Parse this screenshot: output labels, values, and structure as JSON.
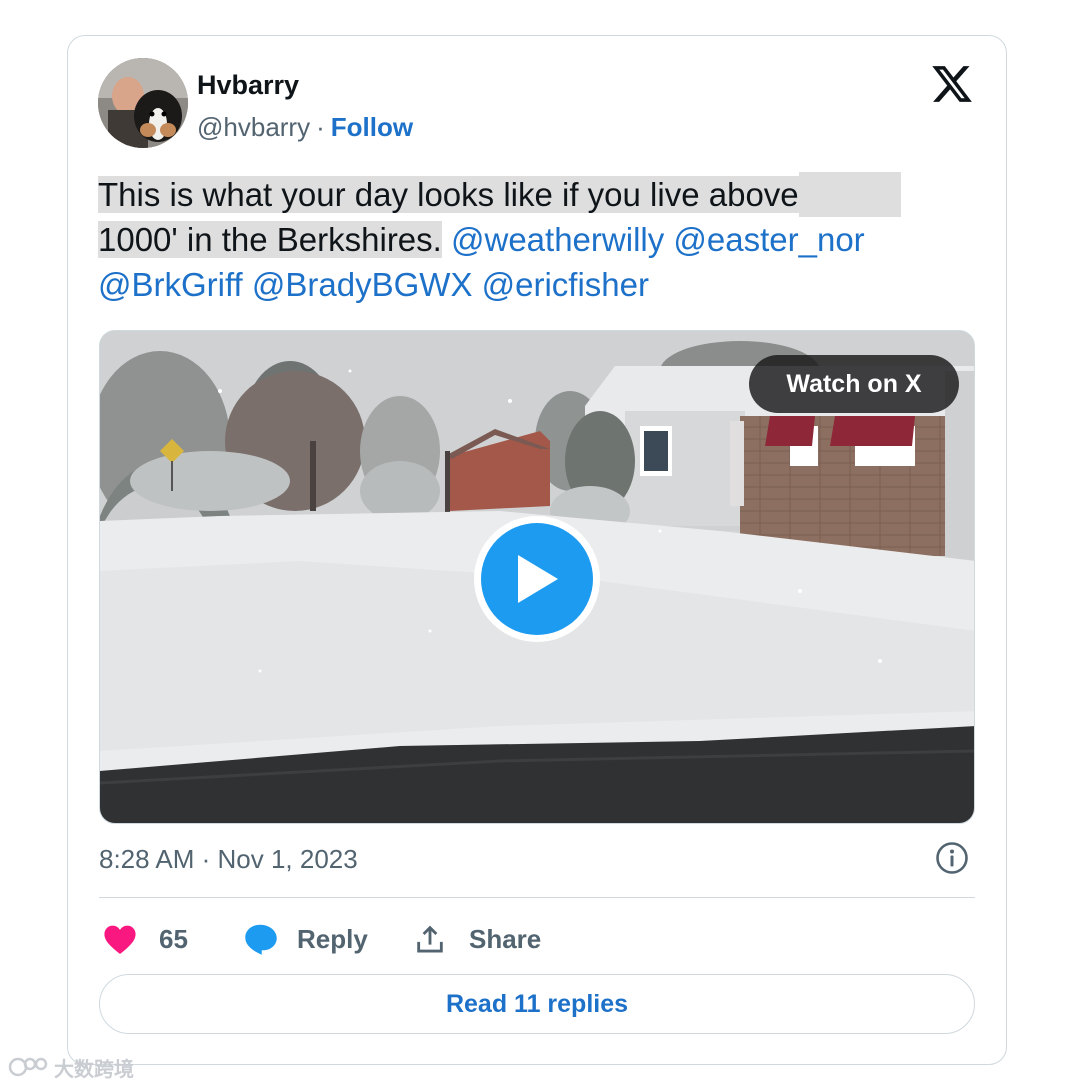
{
  "tweet": {
    "author_name": "Hvbarry",
    "handle": "@hvbarry",
    "separator": "·",
    "follow_label": "Follow",
    "text_part1": "This is what your day looks like if you live above",
    "text_part2": "1000' in the Berkshires.",
    "mentions": [
      "@weatherwilly",
      "@easter_nor",
      "@BrkGriff",
      "@BradyBGWX",
      "@ericfisher"
    ],
    "timestamp": "8:28 AM · Nov 1, 2023"
  },
  "media": {
    "watch_label": "Watch on X",
    "play_icon": "play-icon"
  },
  "actions": {
    "like_count": "65",
    "reply_label": "Reply",
    "share_label": "Share",
    "read_replies_label": "Read 11 replies"
  },
  "watermark": {
    "text": "大数跨境"
  },
  "colors": {
    "link": "#1d71c9",
    "like": "#f91880",
    "reply": "#1d9bf0",
    "muted": "#536471",
    "border": "#cfd9de"
  }
}
